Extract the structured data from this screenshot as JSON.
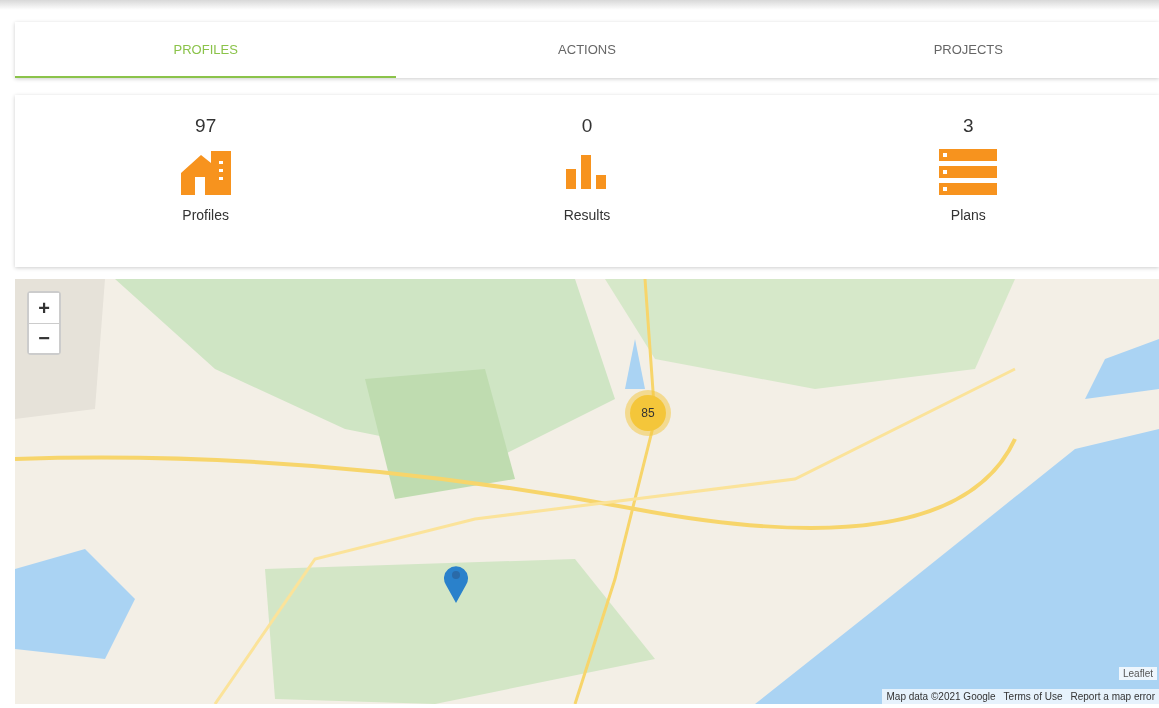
{
  "tabs": [
    {
      "label": "PROFILES",
      "selected": true
    },
    {
      "label": "ACTIONS",
      "selected": false
    },
    {
      "label": "PROJECTS",
      "selected": false
    }
  ],
  "stats": [
    {
      "count": "97",
      "label": "Profiles",
      "kind": "house"
    },
    {
      "count": "0",
      "label": "Results",
      "kind": "bars"
    },
    {
      "count": "3",
      "label": "Plans",
      "kind": "list"
    }
  ],
  "map": {
    "zoom_in": "+",
    "zoom_out": "−",
    "cluster": "85",
    "leaflet": "Leaflet",
    "attribution": [
      "Map data ©2021 Google",
      "Terms of Use",
      "Report a map error"
    ]
  }
}
